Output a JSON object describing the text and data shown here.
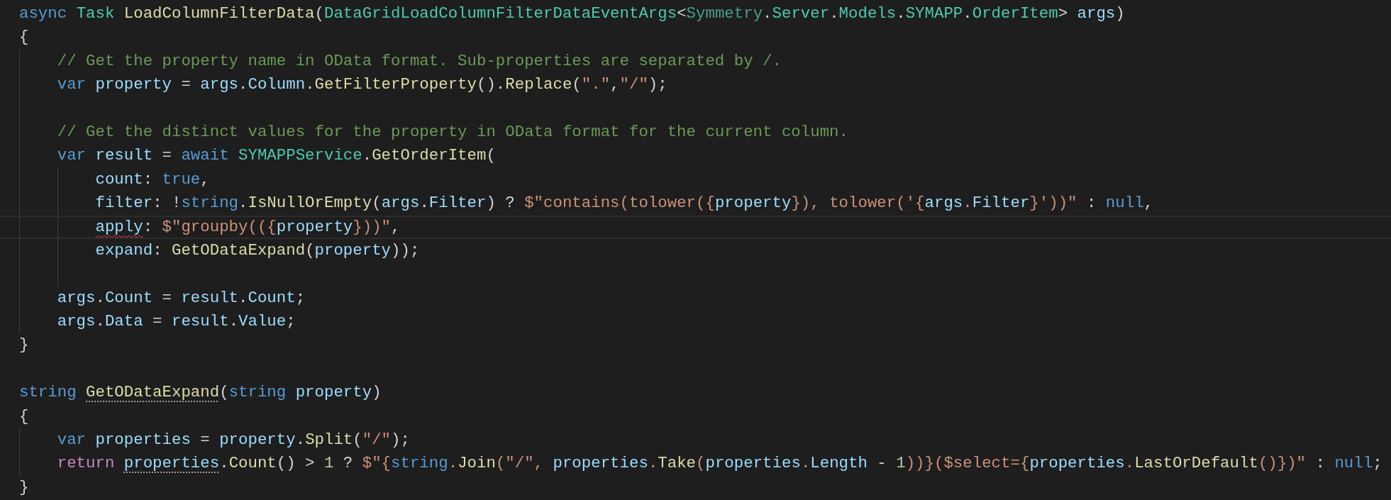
{
  "lines": [
    {
      "kind": "code",
      "selected": false,
      "tokens": [
        {
          "kind": "kw",
          "text": "async "
        },
        {
          "kind": "type",
          "text": "Task "
        },
        {
          "kind": "fn",
          "text": "LoadColumnFilterData"
        },
        {
          "kind": "plain",
          "text": "("
        },
        {
          "kind": "type",
          "text": "DataGridLoadColumnFilterDataEventArgs"
        },
        {
          "kind": "plain",
          "text": "<"
        },
        {
          "kind": "ns",
          "text": "Symmetry"
        },
        {
          "kind": "plain",
          "text": "."
        },
        {
          "kind": "type",
          "text": "Server"
        },
        {
          "kind": "plain",
          "text": "."
        },
        {
          "kind": "type",
          "text": "Models"
        },
        {
          "kind": "plain",
          "text": "."
        },
        {
          "kind": "type",
          "text": "SYMAPP"
        },
        {
          "kind": "plain",
          "text": "."
        },
        {
          "kind": "type",
          "text": "OrderItem"
        },
        {
          "kind": "plain",
          "text": "> "
        },
        {
          "kind": "var",
          "text": "args"
        },
        {
          "kind": "plain",
          "text": ")"
        }
      ]
    },
    {
      "kind": "code",
      "selected": false,
      "tokens": [
        {
          "kind": "plain",
          "text": "{"
        }
      ]
    },
    {
      "kind": "code",
      "selected": false,
      "tokens": [
        {
          "kind": "cmt",
          "text": "    // Get the property name in OData format. Sub-properties are separated by /."
        }
      ]
    },
    {
      "kind": "code",
      "selected": false,
      "tokens": [
        {
          "kind": "kw",
          "text": "    var "
        },
        {
          "kind": "var",
          "text": "property"
        },
        {
          "kind": "plain",
          "text": " = "
        },
        {
          "kind": "var",
          "text": "args"
        },
        {
          "kind": "plain",
          "text": "."
        },
        {
          "kind": "var",
          "text": "Column"
        },
        {
          "kind": "plain",
          "text": "."
        },
        {
          "kind": "fn",
          "text": "GetFilterProperty"
        },
        {
          "kind": "plain",
          "text": "()."
        },
        {
          "kind": "fn",
          "text": "Replace"
        },
        {
          "kind": "plain",
          "text": "("
        },
        {
          "kind": "str",
          "text": "\".\""
        },
        {
          "kind": "plain",
          "text": ","
        },
        {
          "kind": "str",
          "text": "\"/\""
        },
        {
          "kind": "plain",
          "text": ");"
        }
      ]
    },
    {
      "kind": "blank"
    },
    {
      "kind": "code",
      "selected": false,
      "tokens": [
        {
          "kind": "cmt",
          "text": "    // Get the distinct values for the property in OData format for the current column."
        }
      ]
    },
    {
      "kind": "code",
      "selected": false,
      "tokens": [
        {
          "kind": "kw",
          "text": "    var "
        },
        {
          "kind": "var",
          "text": "result"
        },
        {
          "kind": "plain",
          "text": " = "
        },
        {
          "kind": "kw",
          "text": "await "
        },
        {
          "kind": "type",
          "text": "SYMAPPService"
        },
        {
          "kind": "plain",
          "text": "."
        },
        {
          "kind": "fn",
          "text": "GetOrderItem"
        },
        {
          "kind": "plain",
          "text": "("
        }
      ]
    },
    {
      "kind": "code",
      "selected": false,
      "tokens": [
        {
          "kind": "var",
          "text": "        count"
        },
        {
          "kind": "plain",
          "text": ": "
        },
        {
          "kind": "kw",
          "text": "true"
        },
        {
          "kind": "plain",
          "text": ","
        }
      ]
    },
    {
      "kind": "code",
      "selected": false,
      "tokens": [
        {
          "kind": "var",
          "text": "        filter"
        },
        {
          "kind": "plain",
          "text": ": !"
        },
        {
          "kind": "kw",
          "text": "string"
        },
        {
          "kind": "plain",
          "text": "."
        },
        {
          "kind": "fn",
          "text": "IsNullOrEmpty"
        },
        {
          "kind": "plain",
          "text": "("
        },
        {
          "kind": "var",
          "text": "args"
        },
        {
          "kind": "plain",
          "text": "."
        },
        {
          "kind": "var",
          "text": "Filter"
        },
        {
          "kind": "plain",
          "text": ") ? "
        },
        {
          "kind": "str",
          "text": "$\"contains(tolower({"
        },
        {
          "kind": "var",
          "text": "property"
        },
        {
          "kind": "str",
          "text": "}), tolower('{"
        },
        {
          "kind": "var",
          "text": "args"
        },
        {
          "kind": "str",
          "text": "."
        },
        {
          "kind": "var",
          "text": "Filter"
        },
        {
          "kind": "str",
          "text": "}'))\""
        },
        {
          "kind": "plain",
          "text": " : "
        },
        {
          "kind": "kw",
          "text": "null"
        },
        {
          "kind": "plain",
          "text": ","
        }
      ]
    },
    {
      "kind": "code",
      "selected": true,
      "tokens": [
        {
          "kind": "var",
          "text": "        apply",
          "error_underline": true
        },
        {
          "kind": "plain",
          "text": ": "
        },
        {
          "kind": "str",
          "text": "$\"groupby(({"
        },
        {
          "kind": "var",
          "text": "property"
        },
        {
          "kind": "str",
          "text": "}))\""
        },
        {
          "kind": "plain",
          "text": ","
        }
      ]
    },
    {
      "kind": "code",
      "selected": false,
      "tokens": [
        {
          "kind": "var",
          "text": "        expand"
        },
        {
          "kind": "plain",
          "text": ": "
        },
        {
          "kind": "fn",
          "text": "GetODataExpand"
        },
        {
          "kind": "plain",
          "text": "("
        },
        {
          "kind": "var",
          "text": "property"
        },
        {
          "kind": "plain",
          "text": "));"
        }
      ]
    },
    {
      "kind": "blank"
    },
    {
      "kind": "code",
      "selected": false,
      "tokens": [
        {
          "kind": "var",
          "text": "    args"
        },
        {
          "kind": "plain",
          "text": "."
        },
        {
          "kind": "var",
          "text": "Count"
        },
        {
          "kind": "plain",
          "text": " = "
        },
        {
          "kind": "var",
          "text": "result"
        },
        {
          "kind": "plain",
          "text": "."
        },
        {
          "kind": "var",
          "text": "Count"
        },
        {
          "kind": "plain",
          "text": ";"
        }
      ]
    },
    {
      "kind": "code",
      "selected": false,
      "tokens": [
        {
          "kind": "var",
          "text": "    args"
        },
        {
          "kind": "plain",
          "text": "."
        },
        {
          "kind": "var",
          "text": "Data"
        },
        {
          "kind": "plain",
          "text": " = "
        },
        {
          "kind": "var",
          "text": "result"
        },
        {
          "kind": "plain",
          "text": "."
        },
        {
          "kind": "var",
          "text": "Value"
        },
        {
          "kind": "plain",
          "text": ";"
        }
      ]
    },
    {
      "kind": "code",
      "selected": false,
      "tokens": [
        {
          "kind": "plain",
          "text": "}"
        }
      ]
    },
    {
      "kind": "blank"
    },
    {
      "kind": "code",
      "selected": false,
      "tokens": [
        {
          "kind": "kw",
          "text": "string "
        },
        {
          "kind": "fn",
          "text": "GetODataExpand",
          "hint_dots": true
        },
        {
          "kind": "plain",
          "text": "("
        },
        {
          "kind": "kw",
          "text": "string "
        },
        {
          "kind": "var",
          "text": "property"
        },
        {
          "kind": "plain",
          "text": ")"
        }
      ]
    },
    {
      "kind": "code",
      "selected": false,
      "tokens": [
        {
          "kind": "plain",
          "text": "{"
        }
      ]
    },
    {
      "kind": "code",
      "selected": false,
      "tokens": [
        {
          "kind": "kw",
          "text": "    var "
        },
        {
          "kind": "var",
          "text": "properties"
        },
        {
          "kind": "plain",
          "text": " = "
        },
        {
          "kind": "var",
          "text": "property"
        },
        {
          "kind": "plain",
          "text": "."
        },
        {
          "kind": "fn",
          "text": "Split"
        },
        {
          "kind": "plain",
          "text": "("
        },
        {
          "kind": "str",
          "text": "\"/\""
        },
        {
          "kind": "plain",
          "text": ");"
        }
      ]
    },
    {
      "kind": "code",
      "selected": false,
      "tokens": [
        {
          "kind": "ctl",
          "text": "    return "
        },
        {
          "kind": "var",
          "text": "properties",
          "hint_dots": true
        },
        {
          "kind": "plain",
          "text": "."
        },
        {
          "kind": "fn",
          "text": "Count"
        },
        {
          "kind": "plain",
          "text": "() > "
        },
        {
          "kind": "num",
          "text": "1"
        },
        {
          "kind": "plain",
          "text": " ? "
        },
        {
          "kind": "str",
          "text": "$\"{"
        },
        {
          "kind": "kw",
          "text": "string"
        },
        {
          "kind": "str",
          "text": "."
        },
        {
          "kind": "fn",
          "text": "Join"
        },
        {
          "kind": "str",
          "text": "(\"/\", "
        },
        {
          "kind": "var",
          "text": "properties"
        },
        {
          "kind": "str",
          "text": "."
        },
        {
          "kind": "fn",
          "text": "Take"
        },
        {
          "kind": "str",
          "text": "("
        },
        {
          "kind": "var",
          "text": "properties"
        },
        {
          "kind": "str",
          "text": "."
        },
        {
          "kind": "var",
          "text": "Length"
        },
        {
          "kind": "plain",
          "text": " - "
        },
        {
          "kind": "num",
          "text": "1"
        },
        {
          "kind": "str",
          "text": "))}($select={"
        },
        {
          "kind": "var",
          "text": "properties"
        },
        {
          "kind": "str",
          "text": "."
        },
        {
          "kind": "fn",
          "text": "LastOrDefault"
        },
        {
          "kind": "str",
          "text": "()})\""
        },
        {
          "kind": "plain",
          "text": " : "
        },
        {
          "kind": "kw",
          "text": "null"
        },
        {
          "kind": "plain",
          "text": ";"
        }
      ]
    },
    {
      "kind": "code",
      "selected": false,
      "tokens": [
        {
          "kind": "plain",
          "text": "}"
        }
      ]
    }
  ]
}
